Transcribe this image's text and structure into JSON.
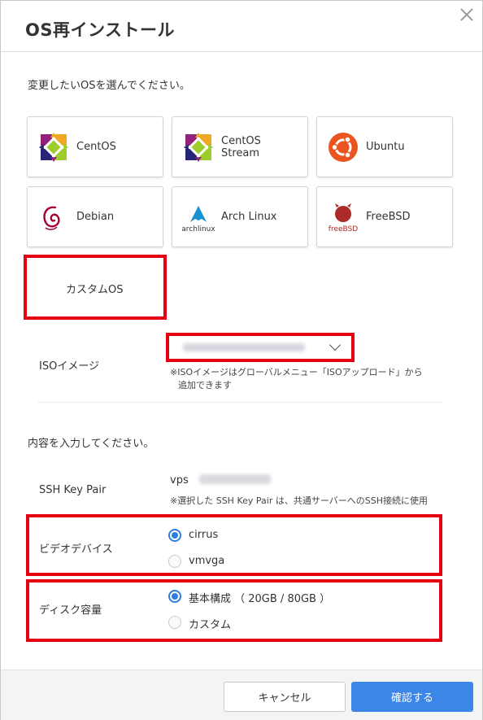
{
  "dialog": {
    "title": "OS再インストール",
    "instruction_os": "変更したいOSを選んでください。",
    "os_options": [
      {
        "label": "CentOS",
        "icon": "centos-logo-icon"
      },
      {
        "label": "CentOS Stream",
        "line1": "CentOS",
        "line2": "Stream",
        "icon": "centos-stream-logo-icon"
      },
      {
        "label": "Ubuntu",
        "icon": "ubuntu-logo-icon"
      },
      {
        "label": "Debian",
        "icon": "debian-logo-icon"
      },
      {
        "label": "Arch Linux",
        "icon": "arch-linux-logo-icon",
        "logo_text": "archlinux"
      },
      {
        "label": "FreeBSD",
        "icon": "freebsd-logo-icon",
        "logo_text": "freeBSD"
      }
    ],
    "custom_os_label": "カスタムOS",
    "iso": {
      "label": "ISOイメージ",
      "note_line1": "※ISOイメージはグローバルメニュー「ISOアップロード」から",
      "note_line2": "追加できます"
    },
    "instruction_content": "内容を入力してください。",
    "ssh": {
      "label": "SSH Key Pair",
      "value_prefix": "vps",
      "note": "※選択した SSH Key Pair は、共通サーバーへのSSH接続に使用"
    },
    "video_device": {
      "label": "ビデオデバイス",
      "options": [
        {
          "label": "cirrus",
          "selected": true
        },
        {
          "label": "vmvga",
          "selected": false
        }
      ]
    },
    "disk": {
      "label": "ディスク容量",
      "options": [
        {
          "label": "基本構成 （ 20GB / 80GB ）",
          "selected": true
        },
        {
          "label": "カスタム",
          "selected": false
        }
      ]
    },
    "buttons": {
      "cancel": "キャンセル",
      "confirm": "確認する"
    },
    "colors": {
      "accent": "#3c86e8",
      "highlight": "#e60012",
      "centos_purple": "#932279",
      "centos_green": "#9ccd2a",
      "centos_orange": "#efa724",
      "centos_blue": "#262577",
      "ubuntu_orange": "#e95420",
      "debian_red": "#a80030",
      "freebsd_red": "#ab2b28",
      "arch_blue": "#1793d1"
    }
  }
}
